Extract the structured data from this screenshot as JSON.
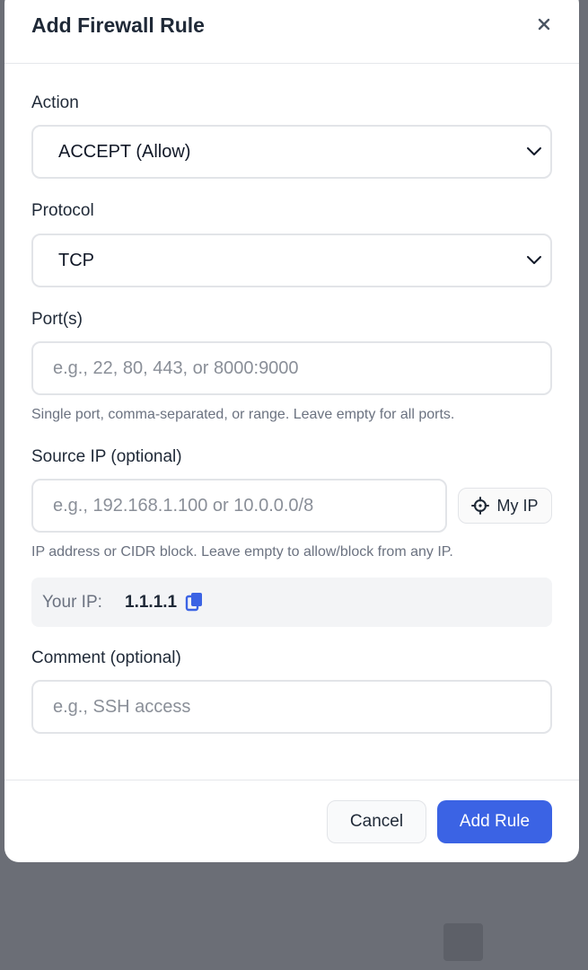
{
  "modal": {
    "title": "Add Firewall Rule",
    "close_label": "×"
  },
  "form": {
    "action": {
      "label": "Action",
      "value": "ACCEPT (Allow)"
    },
    "protocol": {
      "label": "Protocol",
      "value": "TCP"
    },
    "ports": {
      "label": "Port(s)",
      "value": "",
      "placeholder": "e.g., 22, 80, 443, or 8000:9000",
      "help": "Single port, comma-separated, or range. Leave empty for all ports."
    },
    "source_ip": {
      "label": "Source IP (optional)",
      "value": "",
      "placeholder": "e.g., 192.168.1.100 or 10.0.0.0/8",
      "help": "IP address or CIDR block. Leave empty to allow/block from any IP.",
      "my_ip_button": "My IP"
    },
    "your_ip": {
      "label": "Your IP:",
      "value": "1.1.1.1"
    },
    "comment": {
      "label": "Comment (optional)",
      "value": "",
      "placeholder": "e.g., SSH access"
    }
  },
  "footer": {
    "cancel_label": "Cancel",
    "submit_label": "Add Rule"
  },
  "colors": {
    "primary": "#3b63e4",
    "backdrop": "#6b6e76"
  }
}
